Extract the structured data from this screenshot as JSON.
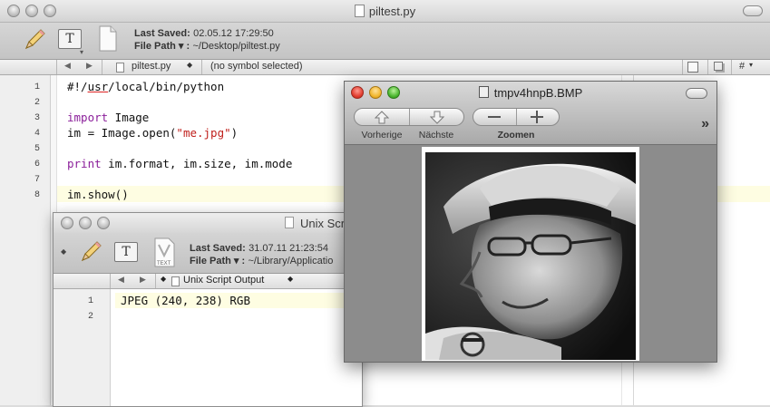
{
  "main": {
    "title": "piltest.py",
    "last_saved_label": "Last Saved:",
    "last_saved_value": "02.05.12 17:29:50",
    "file_path_label": "File Path ▾ :",
    "file_path_value": "~/Desktop/piltest.py",
    "nav_filename": "piltest.py",
    "nav_symbol": "(no symbol selected)",
    "nav_hash": "#",
    "line_numbers": [
      "1",
      "2",
      "3",
      "4",
      "5",
      "6",
      "7",
      "8"
    ],
    "code": {
      "l1_a": "#!/",
      "l1_b": "usr",
      "l1_c": "/local/bin/python",
      "l3_kw": "import",
      "l3_rest": " Image",
      "l4_a": "im = Image.open(",
      "l4_str": "\"me.jpg\"",
      "l4_c": ")",
      "l6_kw": "print",
      "l6_rest": " im.format, im.size, im.mode",
      "l8": "im.show()"
    }
  },
  "output": {
    "title": "Unix Scr",
    "last_saved_label": "Last Saved:",
    "last_saved_value": "31.07.11 21:23:54",
    "file_path_label": "File Path ▾ :",
    "file_path_value": "~/Library/Applicatio",
    "doc_badge": "TEXT",
    "nav_name": "Unix Script Output",
    "line_numbers": [
      "1",
      "2"
    ],
    "line1": "JPEG (240, 238) RGB"
  },
  "viewer": {
    "title": "tmpv4hnpB.BMP",
    "prev_label": "Vorherige",
    "next_label": "Nächste",
    "zoom_label": "Zoomen",
    "overflow": "»"
  },
  "colors": {
    "keyword": "#8b1f9a",
    "string": "#c0201c",
    "current_line": "#fefde2"
  }
}
